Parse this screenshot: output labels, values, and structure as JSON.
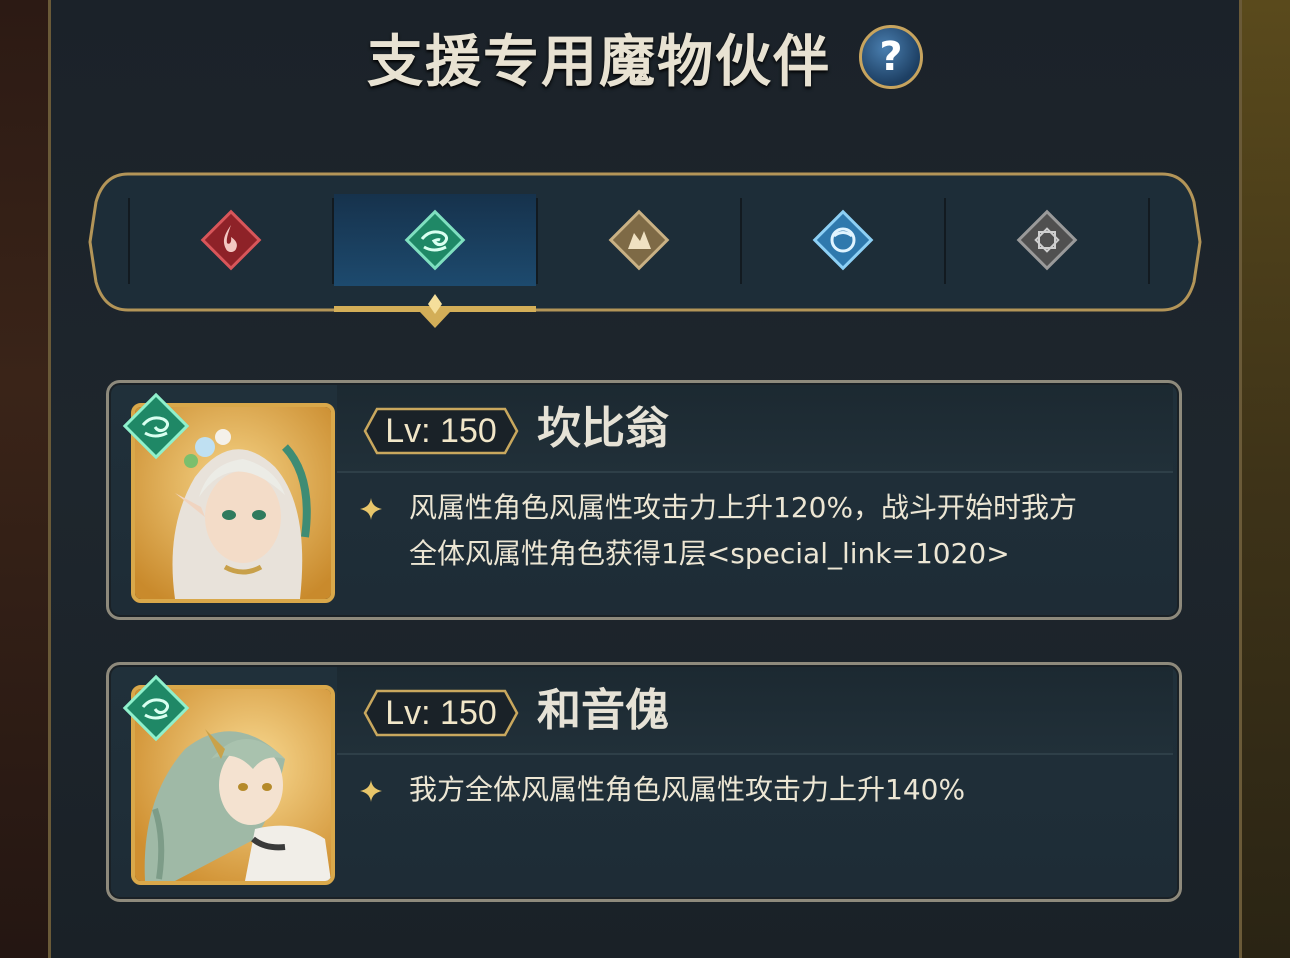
{
  "header": {
    "title": "支援专用魔物伙伴",
    "help_label": "?"
  },
  "element_tabs": [
    {
      "name": "fire",
      "color": "#b83438"
    },
    {
      "name": "wind",
      "color": "#2e9a78",
      "selected": true
    },
    {
      "name": "earth",
      "color": "#a08a62"
    },
    {
      "name": "water",
      "color": "#3f8fc4"
    },
    {
      "name": "neutral",
      "color": "#6c6c6c"
    }
  ],
  "monsters": [
    {
      "level": "Lv: 150",
      "name": "坎比翁",
      "element": "wind",
      "description_lines": [
        "风属性角色风属性攻击力上升120%，战斗开始时我方",
        "全体风属性角色获得1层<special_link=1020>"
      ]
    },
    {
      "level": "Lv: 150",
      "name": "和音傀",
      "element": "wind",
      "description_lines": [
        "我方全体风属性角色风属性攻击力上升140%"
      ]
    }
  ],
  "colors": {
    "gold": "#d9a84a",
    "panel": "#1b2229",
    "text": "#ece6d4"
  }
}
